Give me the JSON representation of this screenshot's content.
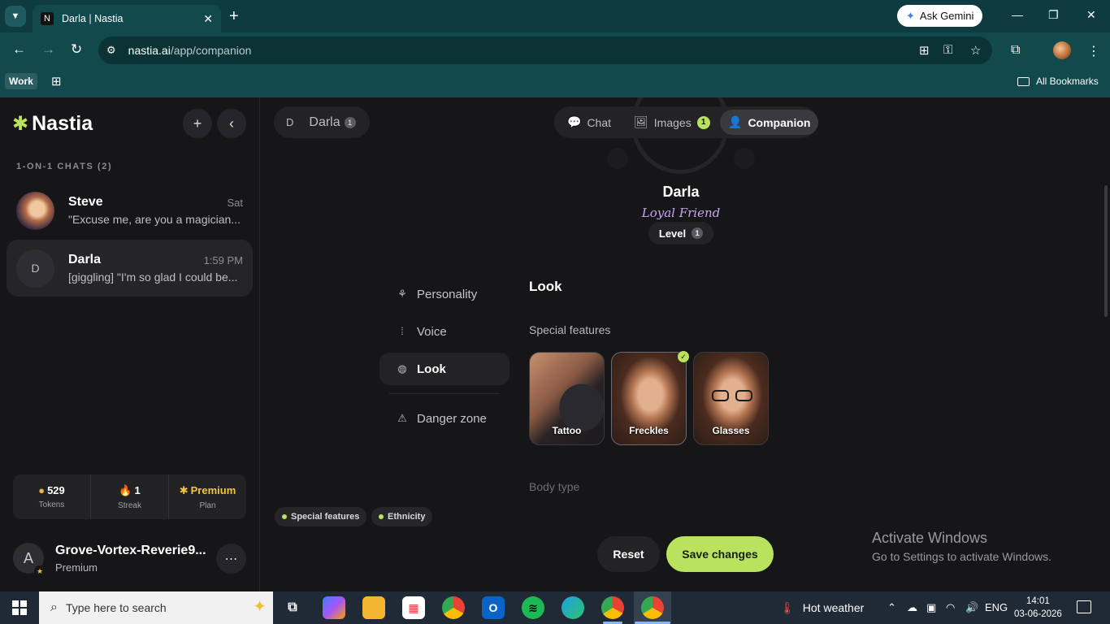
{
  "browser": {
    "tab_title": "Darla | Nastia",
    "tab_favicon": "N",
    "ask_gemini": "Ask Gemini",
    "url_domain": "nastia.ai",
    "url_path": "/app/companion",
    "bookmark_work": "Work",
    "all_bookmarks": "All Bookmarks"
  },
  "sidebar": {
    "logo": "Nastia",
    "section_title": "1-ON-1 CHATS (2)",
    "chats": [
      {
        "name": "Steve",
        "time": "Sat",
        "preview": "\"Excuse me, are you a magician...",
        "avatar": ""
      },
      {
        "name": "Darla",
        "time": "1:59 PM",
        "preview": "[giggling] \"I'm so glad I could be...",
        "avatar": "D"
      }
    ],
    "stats": [
      {
        "value": "529",
        "label": "Tokens",
        "icon": "coin-icon"
      },
      {
        "value": "1",
        "label": "Streak",
        "icon": "fire-icon"
      },
      {
        "value": "Premium",
        "label": "Plan",
        "icon": "star-icon"
      }
    ],
    "user": {
      "initial": "A",
      "name": "Grove-Vortex-Reverie9...",
      "plan": "Premium"
    }
  },
  "main": {
    "companion_chip": {
      "initial": "D",
      "name": "Darla",
      "badge": "1"
    },
    "tabs": [
      {
        "label": "Chat",
        "icon": "chat-bubble-icon"
      },
      {
        "label": "Images",
        "icon": "image-icon",
        "count": "1"
      },
      {
        "label": "Companion",
        "icon": "person-gear-icon"
      }
    ],
    "profile": {
      "name": "Darla",
      "role": "Loyal Friend",
      "level_label": "Level",
      "level": "1"
    },
    "settings_nav": [
      {
        "label": "Personality",
        "icon": "brain-icon"
      },
      {
        "label": "Voice",
        "icon": "waveform-icon"
      },
      {
        "label": "Look",
        "icon": "palette-icon"
      },
      {
        "label": "Danger zone",
        "icon": "warning-icon"
      }
    ],
    "look_title": "Look",
    "special_features_title": "Special features",
    "features": [
      {
        "label": "Tattoo",
        "selected": false
      },
      {
        "label": "Freckles",
        "selected": true
      },
      {
        "label": "Glasses",
        "selected": false
      }
    ],
    "body_type_title": "Body type",
    "tags": [
      "Special features",
      "Ethnicity"
    ],
    "reset": "Reset",
    "save": "Save changes"
  },
  "watermark": {
    "line1": "Activate Windows",
    "line2": "Go to Settings to activate Windows."
  },
  "taskbar": {
    "search_placeholder": "Type here to search",
    "weather": "Hot weather",
    "lang": "ENG",
    "time": "14:01",
    "date": "03-06-2026"
  },
  "colors": {
    "accent": "#b9e25f",
    "role": "#c8a4f5",
    "bg": "#161618",
    "chrome": "#12494d"
  }
}
